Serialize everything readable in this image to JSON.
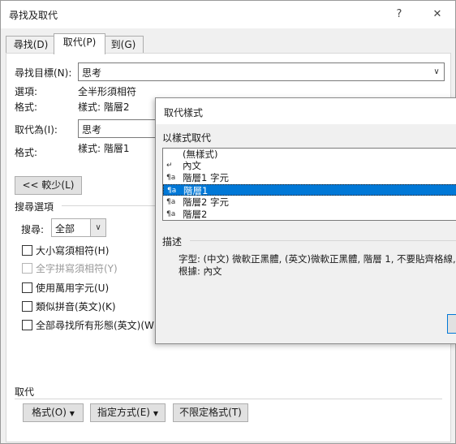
{
  "window": {
    "title": "尋找及取代",
    "help_symbol": "?",
    "close_symbol": "✕"
  },
  "tabs": [
    {
      "label": "尋找(D)"
    },
    {
      "label": "取代(P)"
    },
    {
      "label": "到(G)"
    }
  ],
  "find": {
    "label": "尋找目標(N):",
    "value": "思考",
    "options_label": "選項:",
    "options_value": "全半形須相符",
    "format_label": "格式:",
    "format_value": "樣式: 階層2"
  },
  "replace": {
    "label": "取代為(I):",
    "value": "思考",
    "format_label": "格式:",
    "format_value": "樣式: 階層1"
  },
  "less_button": "<< 較少(L)",
  "search_options": {
    "section_label": "搜尋選項",
    "search_label": "搜尋:",
    "search_value": "全部",
    "checkboxes": [
      {
        "label": "大小寫須相符(H)",
        "enabled": true
      },
      {
        "label": "全字拼寫須相符(Y)",
        "enabled": false
      },
      {
        "label": "使用萬用字元(U)",
        "enabled": true
      },
      {
        "label": "類似拼音(英文)(K)",
        "enabled": true
      },
      {
        "label": "全部尋找所有形態(英文)(W)",
        "enabled": true
      }
    ]
  },
  "replace_section": {
    "label": "取代",
    "format_button": "格式(O)",
    "special_button": "指定方式(E)",
    "no_format_button": "不限定格式(T)"
  },
  "replace_style_dialog": {
    "title": "取代樣式",
    "list_label": "以樣式取代",
    "styles": [
      {
        "icon": "",
        "label": "(無樣式)"
      },
      {
        "icon": "↵",
        "label": "內文"
      },
      {
        "icon": "¶a",
        "label": "階層1 字元"
      },
      {
        "icon": "¶a",
        "label": "階層1",
        "selected": true
      },
      {
        "icon": "¶a",
        "label": "階層2 字元"
      },
      {
        "icon": "¶a",
        "label": "階層2"
      }
    ],
    "description_label": "描述",
    "description_line1": "字型: (中文) 微軟正黑體, (英文)微軟正黑體, 階層 1, 不要貼齊格線, 樣",
    "description_line2": "根據: 內文"
  },
  "accent_color": "#0078d7"
}
